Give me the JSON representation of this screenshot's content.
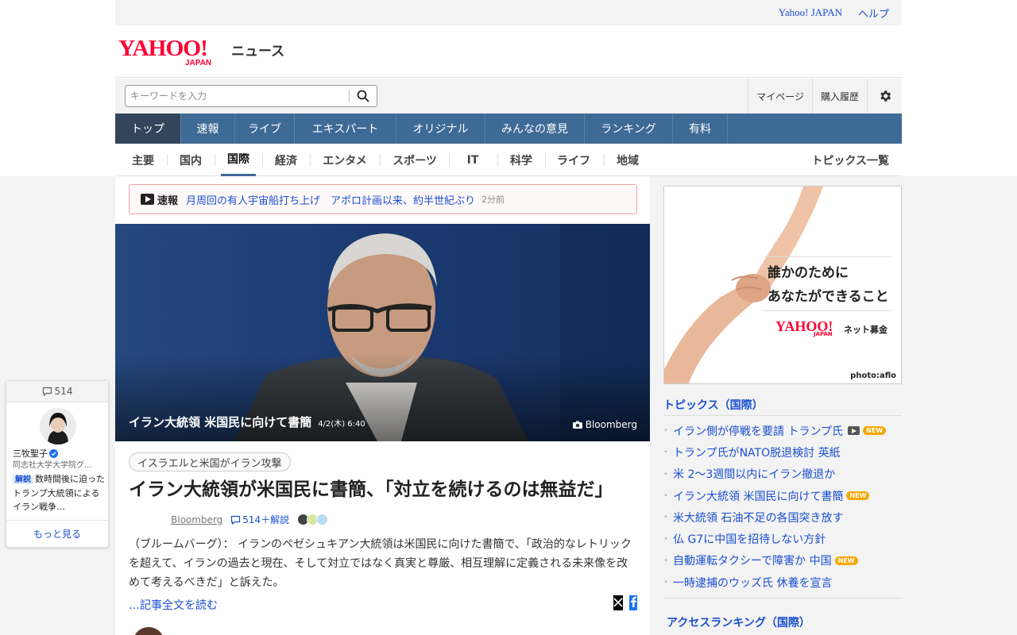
{
  "util_bar": {
    "yahoo_japan_link": "Yahoo! JAPAN",
    "help_link": "ヘルプ"
  },
  "logo": {
    "brand": "YAHOO!",
    "brand_sub": "JAPAN",
    "service": "ニュース"
  },
  "search": {
    "placeholder": "キーワードを入力",
    "value": ""
  },
  "header_links": {
    "mypage": "マイページ",
    "purchase_history": "購入履歴"
  },
  "main_nav": [
    {
      "label": "トップ",
      "active": true
    },
    {
      "label": "速報"
    },
    {
      "label": "ライブ"
    },
    {
      "label": "エキスパート"
    },
    {
      "label": "オリジナル"
    },
    {
      "label": "みんなの意見"
    },
    {
      "label": "ランキング"
    },
    {
      "label": "有料"
    }
  ],
  "sub_nav": [
    {
      "label": "主要"
    },
    {
      "label": "国内"
    },
    {
      "label": "国際",
      "active": true
    },
    {
      "label": "経済"
    },
    {
      "label": "エンタメ"
    },
    {
      "label": "スポーツ"
    },
    {
      "label": "IT"
    },
    {
      "label": "科学"
    },
    {
      "label": "ライフ"
    },
    {
      "label": "地域"
    }
  ],
  "topics_all_link": "トピックス一覧",
  "breaking": {
    "label": "速報",
    "text": "月周回の有人宇宙船打ち上げ　アポロ計画以来、約半世紀ぶり",
    "time": "2分前"
  },
  "hero": {
    "caption": "イラン大統領 米国民に向けて書簡",
    "date": "4/2(木) 6:40",
    "source": "Bloomberg"
  },
  "article": {
    "tag": "イスラエルと米国がイラン攻撃",
    "headline": "イラン大統領が米国民に書簡、「対立を続けるのは無益だ」",
    "source": "Bloomberg",
    "comments": "514＋解説",
    "summary": "（ブルームバーグ）： イランのペゼシュキアン大統領は米国民に向けた書簡で、「政治的なレトリックを超えて、イランの過去と現在、そして対立ではなく真実と尊厳、相互理解に定義される未来像を改めて考えるべきだ」と訴えた。",
    "read_more": "…記事全文を読む"
  },
  "expert_card": {
    "comment_count": "514",
    "name": "三牧聖子",
    "affiliation": "同志社大学大学院グ…",
    "badge": "解説",
    "snippet": "数時間後に迫ったトランプ大統領によるイラン戦争…",
    "more": "もっと見る"
  },
  "ad": {
    "line1": "誰かのために",
    "line2": "あなたができること",
    "logo": "YAHOO!",
    "logo_sub": "JAPAN",
    "service": "ネット募金",
    "credit": "photo:aflo"
  },
  "topics": {
    "heading": "トピックス（国際）",
    "items": [
      {
        "text": "イラン側が停戦を要請 トランプ氏",
        "video": true,
        "new": "NEW"
      },
      {
        "text": "トランプ氏がNATO脱退検討 英紙"
      },
      {
        "text": "米 2～3週間以内にイラン撤退か"
      },
      {
        "text": "イラン大統領 米国民に向けて書簡",
        "new": "NEW"
      },
      {
        "text": "米大統領 石油不足の各国突き放す"
      },
      {
        "text": "仏 G7に中国を招待しない方針"
      },
      {
        "text": "自動運転タクシーで障害か 中国",
        "new": "NEW"
      },
      {
        "text": "一時逮捕のウッズ氏 休養を宣言"
      }
    ]
  },
  "ranking": {
    "heading": "アクセスランキング（国際）"
  },
  "colors": {
    "nav_blue": "#3e6a96",
    "link_blue": "#1a4fd0",
    "brand_red": "#ff0033",
    "new_badge": "#f5a800"
  }
}
